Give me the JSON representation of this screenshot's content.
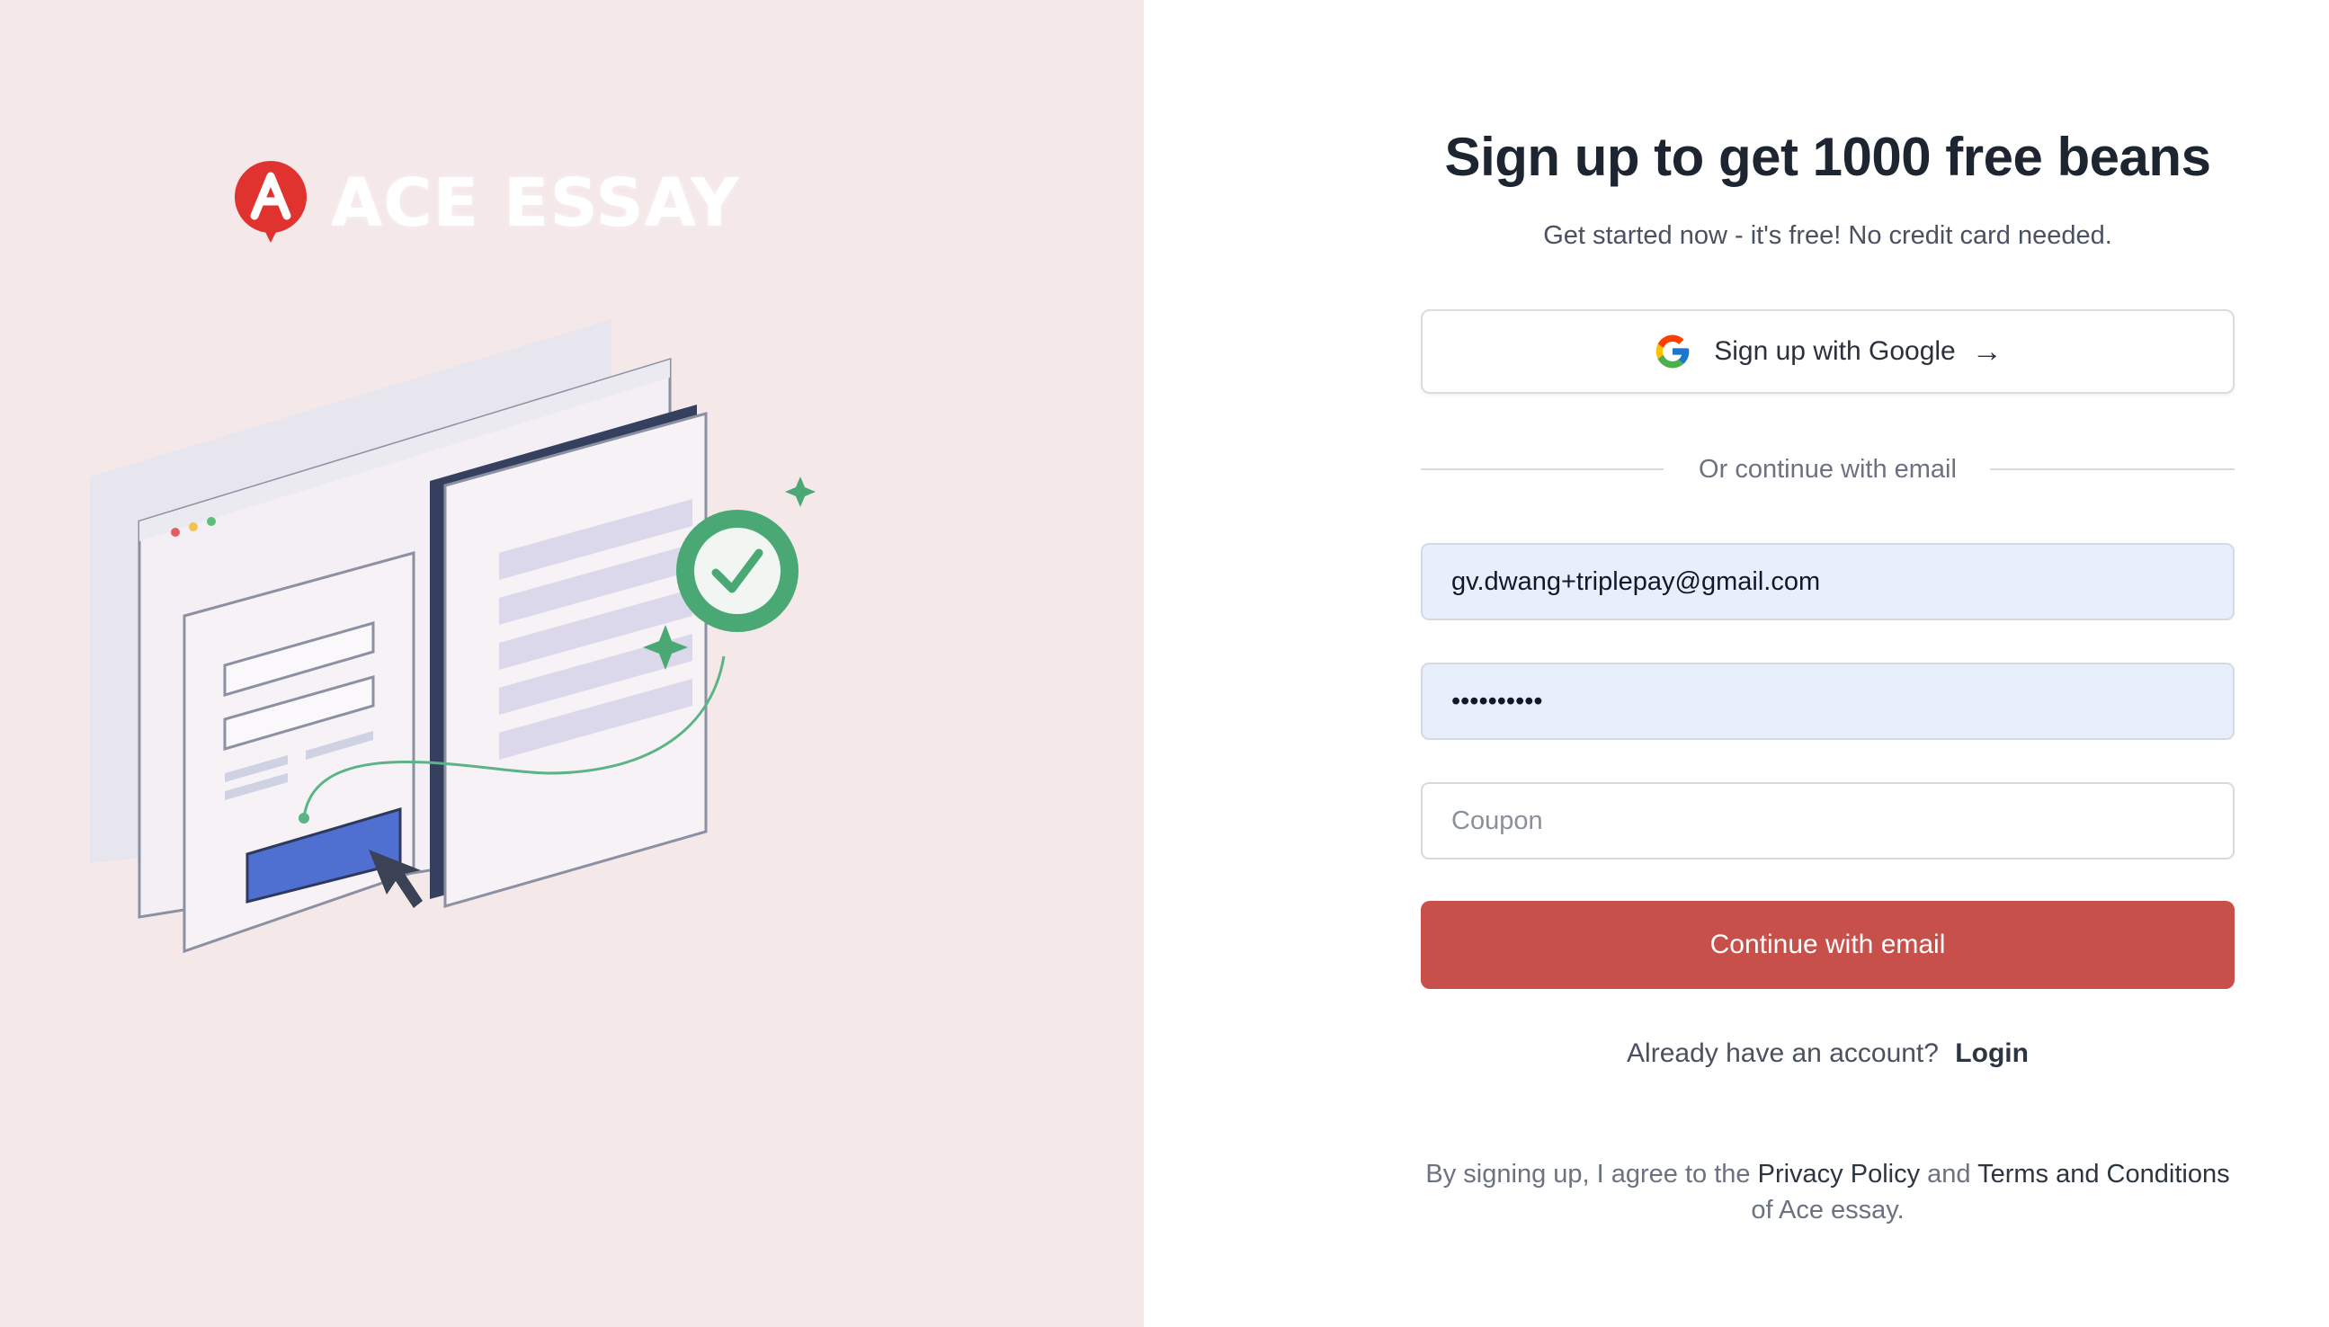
{
  "brand": {
    "name": "ACE ESSAY",
    "logo_letter": "A",
    "accent_color": "#c8504a"
  },
  "signup": {
    "title": "Sign up to get 1000 free beans",
    "subtitle": "Get started now - it's free! No credit card needed.",
    "google_button_label": "Sign up with Google",
    "google_arrow": "→",
    "divider_text": "Or continue with email",
    "email_value": "gv.dwang+triplepay@gmail.com",
    "password_value": "••••••••••",
    "coupon_placeholder": "Coupon",
    "submit_label": "Continue with email",
    "login_prompt": "Already have an account?",
    "login_link": "Login",
    "terms_prefix": "By signing up, I agree to the",
    "privacy_link": "Privacy Policy",
    "terms_and": "and",
    "terms_link": "Terms and Conditions",
    "terms_suffix": "of Ace essay."
  },
  "icons": {
    "google": "google-g-icon",
    "arrow": "arrow-right-icon",
    "logo": "ace-logo-icon"
  }
}
